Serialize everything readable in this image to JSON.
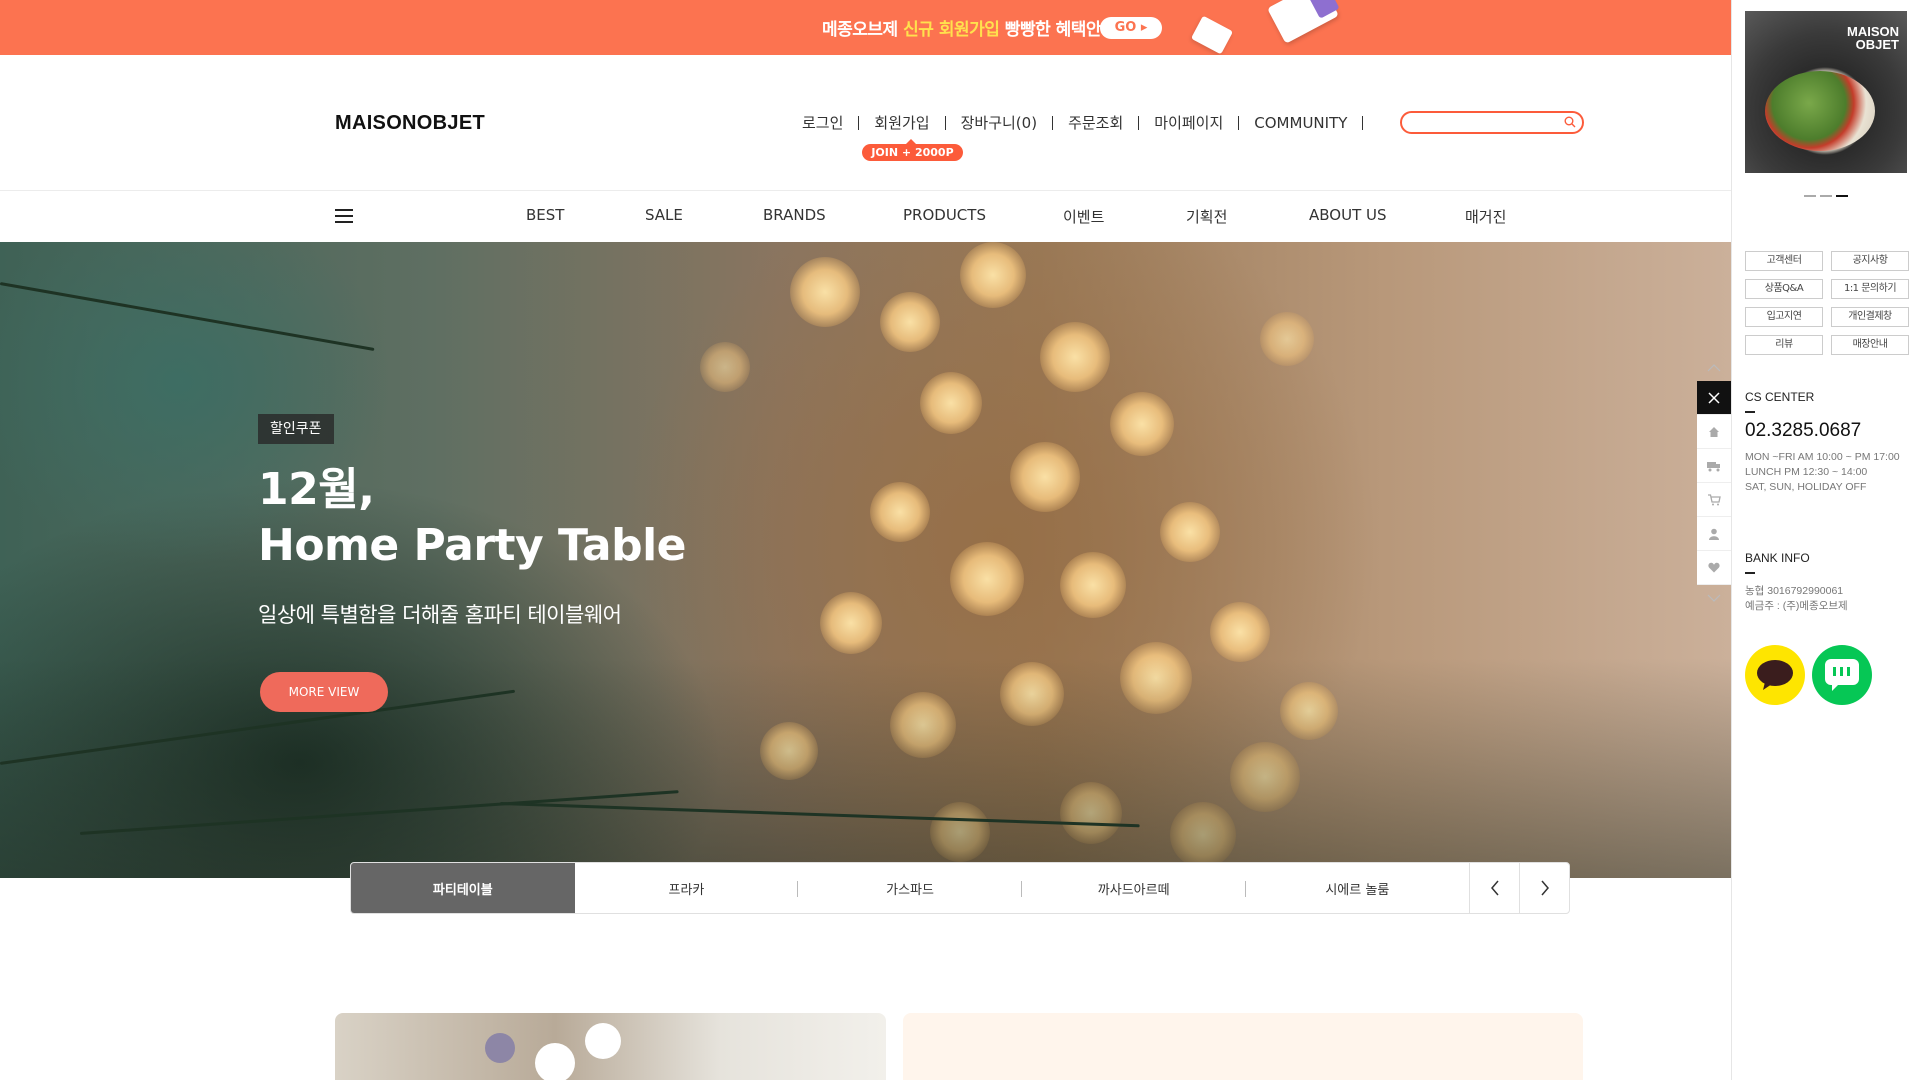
{
  "promo": {
    "text_before": "메종오브제 ",
    "highlight": "신규 회원가입",
    "text_after": " 빵빵한 혜택안내",
    "go_label": "GO ▸",
    "accent_color": "#fc7350"
  },
  "header": {
    "logo": "MAISONOBJET",
    "util_nav": [
      "로그인",
      "회원가입",
      "장바구니(0)",
      "주문조회",
      "마이페이지",
      "COMMUNITY"
    ],
    "join_badge": "JOIN + 2000P",
    "search_placeholder": ""
  },
  "gnb": {
    "items": [
      "BEST",
      "SALE",
      "BRANDS",
      "PRODUCTS",
      "이벤트",
      "기획전",
      "ABOUT US",
      "매거진"
    ]
  },
  "hero": {
    "tag": "할인쿠폰",
    "title_line1": "12월,",
    "title_line2": "Home Party Table",
    "subtitle": "일상에 특별함을 더해줄 홈파티 테이블웨어",
    "button": "MORE VIEW",
    "button_color": "#ef6a5b"
  },
  "hero_tabs": {
    "items": [
      "파티테이블",
      "프라카",
      "가스파드",
      "까사드아르떼",
      "시에르 놀룸"
    ],
    "active_index": 0
  },
  "quickbar": {
    "icons": [
      "close-icon",
      "home-icon",
      "truck-icon",
      "cart-icon",
      "user-icon",
      "heart-icon"
    ]
  },
  "side": {
    "image_text": "MAISON\nOBJET",
    "buttons": [
      "고객센터",
      "공지사항",
      "상품Q&A",
      "1:1 문의하기",
      "입고지연",
      "개인결제창",
      "리뷰",
      "매장안내"
    ],
    "cs_title": "CS CENTER",
    "cs_phone": "02.3285.0687",
    "cs_hours": [
      "MON ~FRI AM 10:00 ~ PM 17:00",
      "LUNCH PM 12:30 ~ 14:00",
      "SAT, SUN, HOLIDAY OFF"
    ],
    "bank_title": "BANK INFO",
    "bank_lines": [
      "농협 3016792990061",
      "예금주 : (주)메종오브제"
    ]
  }
}
